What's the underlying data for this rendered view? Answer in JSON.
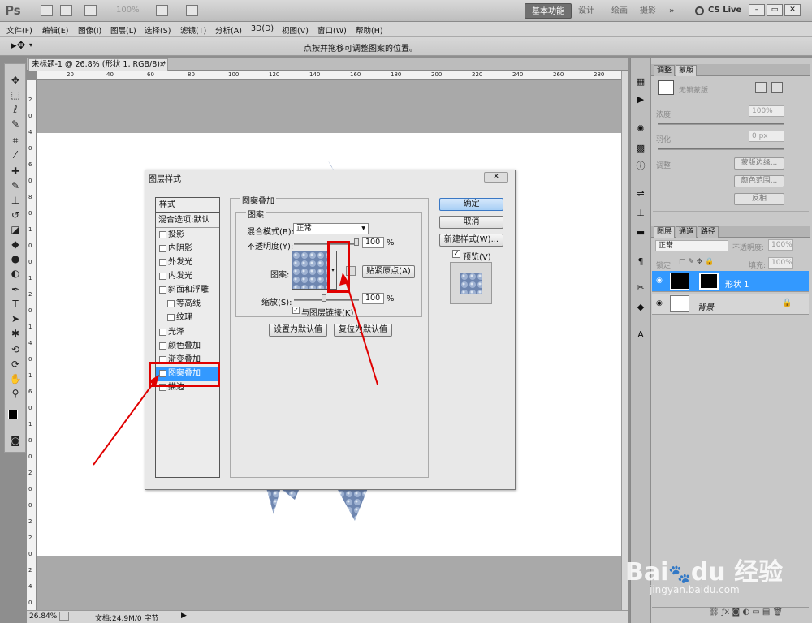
{
  "app": {
    "logo": "Ps",
    "zoom": "100%",
    "workspaces": [
      "基本功能",
      "设计",
      "绘画",
      "摄影"
    ],
    "more": "»",
    "cslive": "CS Live"
  },
  "menu": [
    "文件(F)",
    "编辑(E)",
    "图像(I)",
    "图层(L)",
    "选择(S)",
    "滤镜(T)",
    "分析(A)",
    "3D(D)",
    "视图(V)",
    "窗口(W)",
    "帮助(H)"
  ],
  "options": {
    "hint": "点按并拖移可调整图案的位置。"
  },
  "document": {
    "tab": "未标题-1 @ 26.8% (形状 1, RGB/8) *",
    "ruler_h": [
      "20",
      "40",
      "60",
      "80",
      "100",
      "120",
      "140",
      "160",
      "180",
      "200",
      "220",
      "240",
      "260",
      "280"
    ],
    "ruler_v": [
      "2",
      "0",
      "4",
      "0",
      "6",
      "0",
      "8",
      "0",
      "1",
      "0",
      "0",
      "1",
      "2",
      "0",
      "1",
      "4",
      "0",
      "1",
      "6",
      "0",
      "1",
      "8",
      "0",
      "2",
      "0",
      "0",
      "2",
      "2",
      "0",
      "2",
      "4",
      "0"
    ],
    "zoom_status": "26.84%",
    "doc_status": "文档:24.9M/0 字节"
  },
  "masks_panel": {
    "tabs": [
      "调整",
      "蒙版"
    ],
    "no_mask": "无锁蒙版",
    "density_label": "浓度:",
    "density": "100%",
    "feather_label": "羽化:",
    "feather": "0 px",
    "refine_label": "调整:",
    "btn_edge": "蒙版边缘...",
    "btn_color": "颜色范围...",
    "btn_invert": "反相"
  },
  "layers_panel": {
    "tabs": [
      "图层",
      "通道",
      "路径"
    ],
    "blend": "正常",
    "opacity_label": "不透明度:",
    "opacity": "100%",
    "lock_label": "锁定:",
    "fill_label": "填充:",
    "fill": "100%",
    "layers": [
      {
        "name": "形状 1"
      },
      {
        "name": "背景"
      }
    ]
  },
  "dialog": {
    "title": "图层样式",
    "styles_header": "样式",
    "blending": "混合选项:默认",
    "items": [
      {
        "label": "投影",
        "checked": false
      },
      {
        "label": "内阴影",
        "checked": false
      },
      {
        "label": "外发光",
        "checked": false
      },
      {
        "label": "内发光",
        "checked": false
      },
      {
        "label": "斜面和浮雕",
        "checked": false
      },
      {
        "label": "等高线",
        "checked": false
      },
      {
        "label": "纹理",
        "checked": false
      },
      {
        "label": "光泽",
        "checked": false
      },
      {
        "label": "颜色叠加",
        "checked": false
      },
      {
        "label": "渐变叠加",
        "checked": false
      },
      {
        "label": "图案叠加",
        "checked": true
      },
      {
        "label": "描边",
        "checked": false
      }
    ],
    "group_title": "图案叠加",
    "sub_title": "图案",
    "blend_label": "混合模式(B):",
    "blend_value": "正常",
    "opacity_label": "不透明度(Y):",
    "opacity_value": "100",
    "percent": "%",
    "pattern_label": "图案:",
    "snap_btn": "贴紧原点(A)",
    "scale_label": "缩放(S):",
    "scale_value": "100",
    "link_label": "与图层链接(K)",
    "link_checked": true,
    "set_default": "设置为默认值",
    "reset_default": "复位为默认值",
    "ok": "确定",
    "cancel": "取消",
    "new_style": "新建样式(W)...",
    "preview": "预览(V)"
  },
  "colors": {
    "accent": "#3399ff",
    "highlight": "#e00000",
    "pattern": "#6e86b0"
  }
}
